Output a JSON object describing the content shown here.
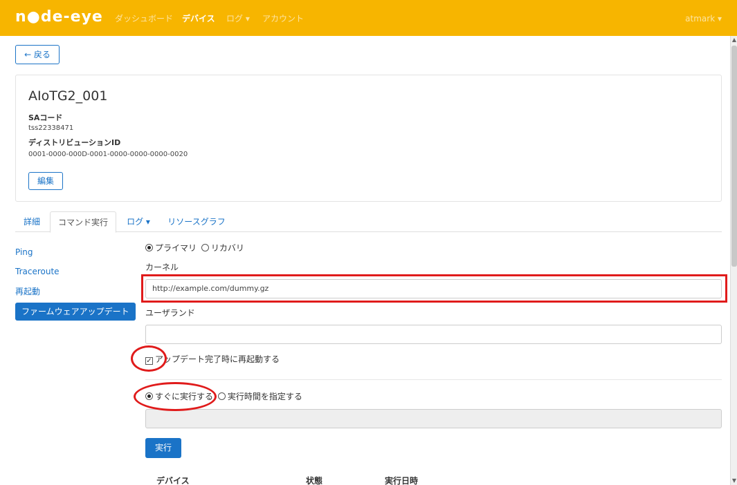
{
  "nav": {
    "brand": "n●de-eye",
    "items": [
      "ダッシュボード",
      "デバイス",
      "ログ ▾",
      "アカウント"
    ],
    "user": "atmark ▾"
  },
  "back_label": "← 戻る",
  "device": {
    "name": "AIoTG2_001",
    "sa_label": "SAコード",
    "sa_value": "tss22338471",
    "dist_label": "ディストリビューションID",
    "dist_value": "0001-0000-000D-0001-0000-0000-0000-0020",
    "edit_label": "編集"
  },
  "tabs": [
    "詳細",
    "コマンド実行",
    "ログ ▾",
    "リソースグラフ"
  ],
  "side": [
    "Ping",
    "Traceroute",
    "再起動",
    "ファームウェアアップデート"
  ],
  "form": {
    "primary_label": "プライマリ",
    "recovery_label": "リカバリ",
    "kernel_label": "カーネル",
    "kernel_value": "http://example.com/dummy.gz",
    "userland_label": "ユーザランド",
    "userland_value": "",
    "reboot_label": "アップデート完了時に再起動する",
    "now_label": "すぐに実行する",
    "schedule_label": "実行時間を指定する",
    "exec_label": "実行"
  },
  "table_headers": [
    "デバイス",
    "状態",
    "実行日時"
  ],
  "colors": {
    "navbar": "#f7b500",
    "primary": "#1a73c7",
    "annotation": "#e01b1b"
  }
}
